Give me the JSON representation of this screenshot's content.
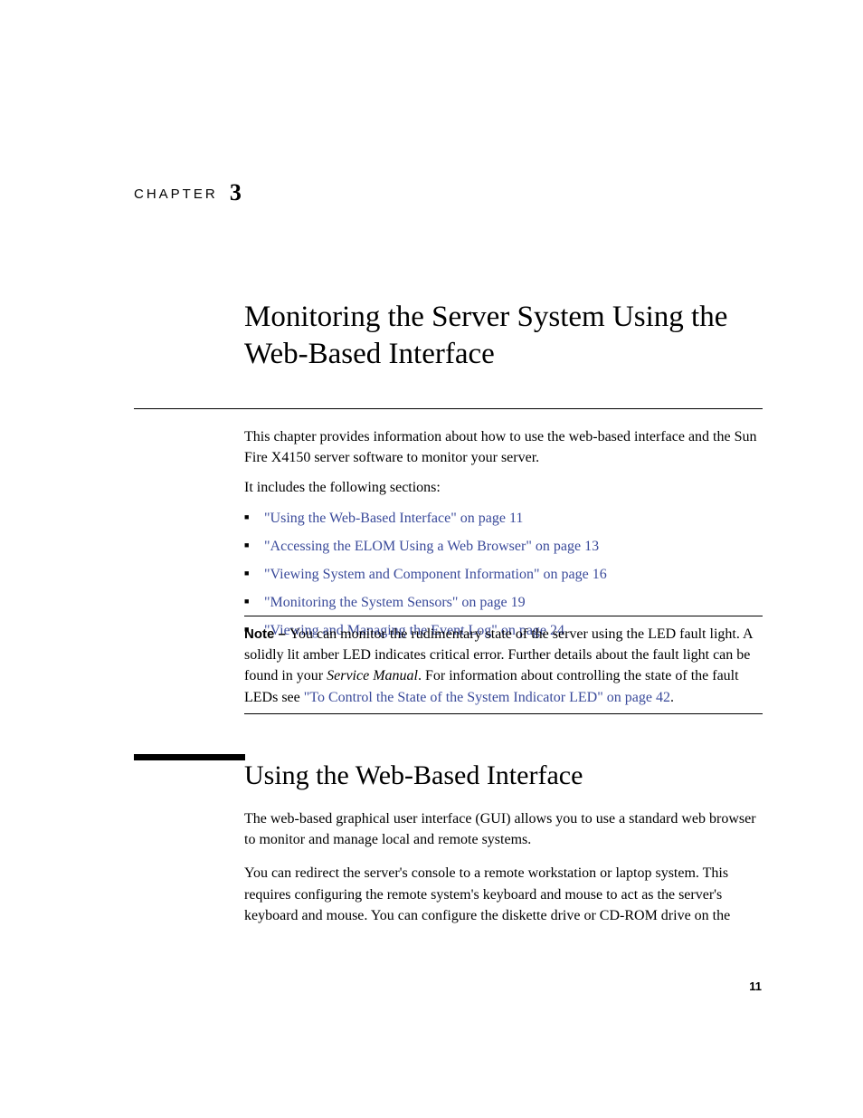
{
  "chapter": {
    "label": "CHAPTER",
    "number": "3"
  },
  "title": "Monitoring the Server System Using the Web-Based Interface",
  "intro": {
    "p1": "This chapter provides information about how to use the web-based interface and the Sun Fire X4150 server software to monitor your server.",
    "p2": "It includes the following sections:"
  },
  "sections": [
    "\"Using the Web-Based Interface\" on page 11",
    "\"Accessing the ELOM Using a Web Browser\" on page 13",
    "\"Viewing System and Component Information\" on page 16",
    "\"Monitoring the System Sensors\" on page 19",
    "\"Viewing and Managing the Event Log\" on page 24"
  ],
  "note": {
    "label": "Note – ",
    "text_a": "You can monitor the rudimentary state of the server using the LED fault light. A solidly lit amber LED indicates critical error. Further details about the fault light can be found in your ",
    "italic": "Service Manual",
    "text_b": ". For information about controlling the state of the fault LEDs see ",
    "link": "\"To Control the State of the System Indicator LED\" on page 42",
    "text_c": "."
  },
  "section2": {
    "heading": "Using the Web-Based Interface",
    "p1": "The web-based graphical user interface (GUI) allows you to use a standard web browser to monitor and manage local and remote systems.",
    "p2": "You can redirect the server's console to a remote workstation or laptop system. This requires configuring the remote system's keyboard and mouse to act as the server's keyboard and mouse. You can configure the diskette drive or CD-ROM drive on the"
  },
  "page_number": "11"
}
